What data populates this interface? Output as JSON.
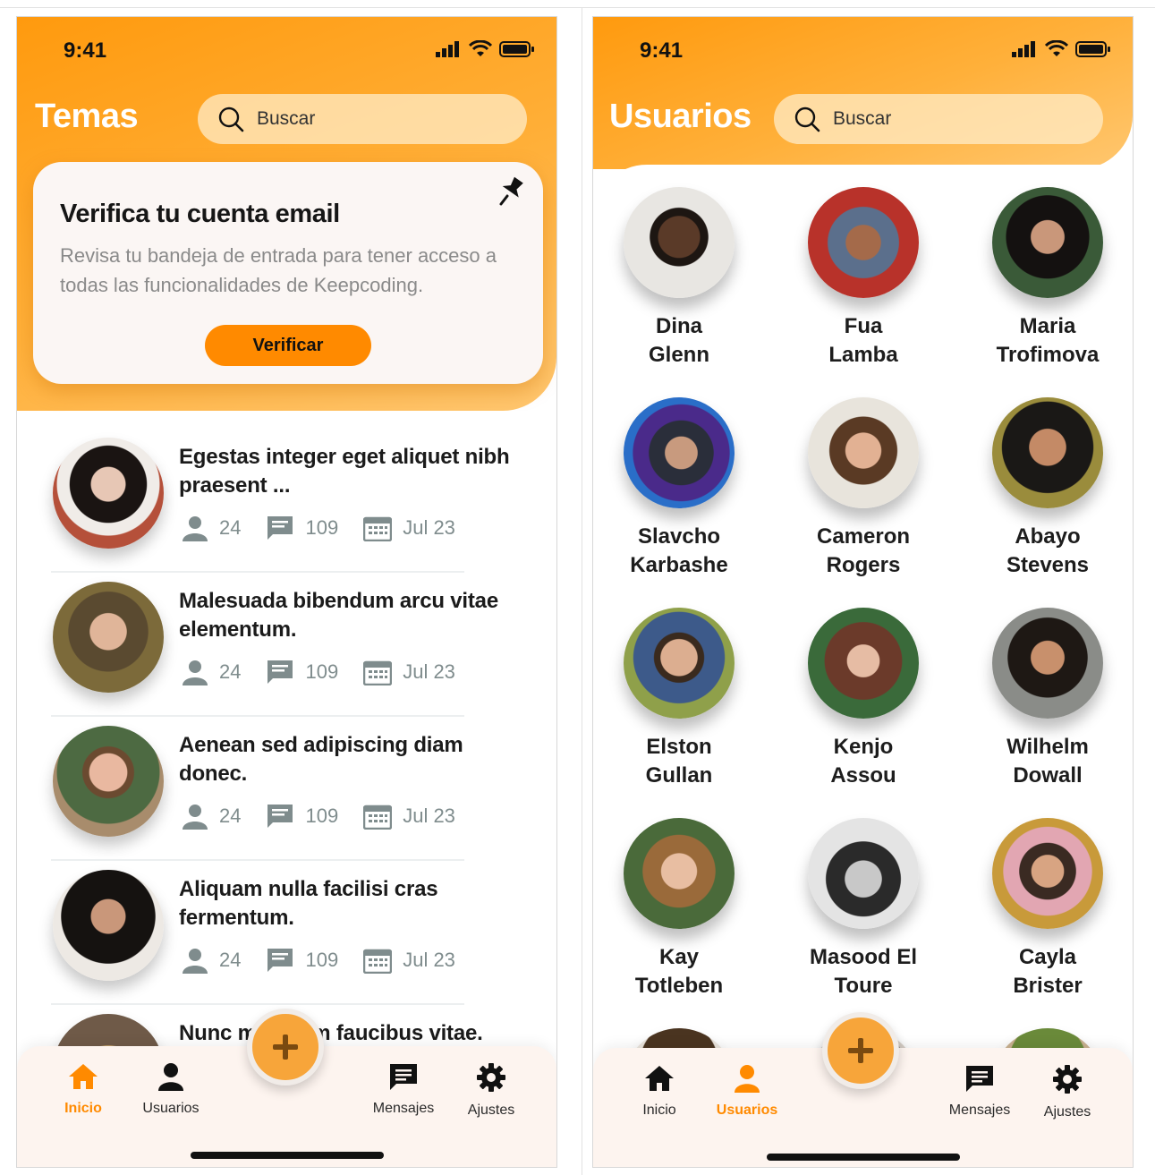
{
  "status": {
    "time": "9:41"
  },
  "colors": {
    "accent": "#ff8a00",
    "header_start": "#ff9a0e",
    "header_end": "#ffc770",
    "tab_active": "#ff8a00"
  },
  "left": {
    "title": "Temas",
    "search_placeholder": "Buscar",
    "verify": {
      "title": "Verifica tu cuenta email",
      "description": "Revisa tu bandeja de entrada para tener acceso a todas las funcionalidades de Keepcoding.",
      "button": "Verificar",
      "icon": "pin-icon"
    },
    "topics": [
      {
        "title": "Egestas integer eget aliquet nibh praesent ...",
        "users": "24",
        "comments": "109",
        "date": "Jul 23"
      },
      {
        "title": "Malesuada bibendum arcu vitae elementum.",
        "users": "24",
        "comments": "109",
        "date": "Jul 23"
      },
      {
        "title": "Aenean sed adipiscing diam donec.",
        "users": "24",
        "comments": "109",
        "date": "Jul 23"
      },
      {
        "title": "Aliquam nulla facilisi cras fermentum.",
        "users": "24",
        "comments": "109",
        "date": "Jul 23"
      },
      {
        "title": "Nunc mi ipsum faucibus vitae.",
        "users": "",
        "comments": "",
        "date": ""
      }
    ]
  },
  "right": {
    "title": "Usuarios",
    "search_placeholder": "Buscar",
    "users": [
      {
        "first": "Dina",
        "last": "Glenn"
      },
      {
        "first": "Fua",
        "last": "Lamba"
      },
      {
        "first": "Maria",
        "last": "Trofimova"
      },
      {
        "first": "Slavcho",
        "last": "Karbashe"
      },
      {
        "first": "Cameron",
        "last": "Rogers"
      },
      {
        "first": "Abayo",
        "last": "Stevens"
      },
      {
        "first": "Elston",
        "last": "Gullan"
      },
      {
        "first": "Kenjo",
        "last": "Assou"
      },
      {
        "first": "Wilhelm",
        "last": "Dowall"
      },
      {
        "first": "Kay",
        "last": "Totleben"
      },
      {
        "first": "Masood El",
        "last": "Toure"
      },
      {
        "first": "Cayla",
        "last": "Brister"
      }
    ]
  },
  "tabs": {
    "inicio": "Inicio",
    "usuarios": "Usuarios",
    "mensajes": "Mensajes",
    "ajustes": "Ajustes"
  },
  "fab": {
    "icon": "plus-icon"
  }
}
